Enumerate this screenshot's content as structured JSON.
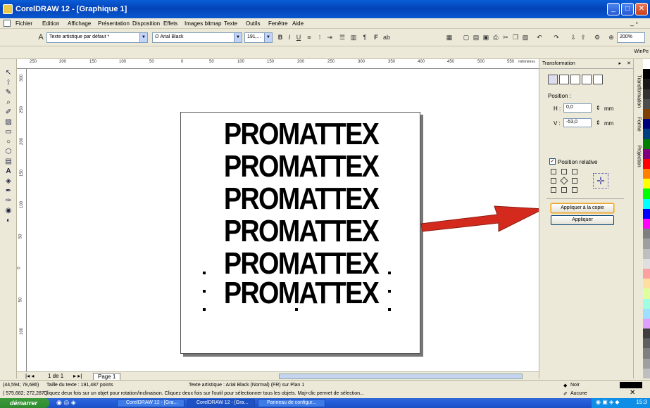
{
  "window": {
    "title": "CorelDRAW 12 - [Graphique 1]",
    "minimize": "_",
    "maximize": "□",
    "close": "✕"
  },
  "menu": [
    "Fichier",
    "Edition",
    "Affichage",
    "Présentation",
    "Disposition",
    "Effets",
    "Images bitmap",
    "Texte",
    "Outils",
    "Fenêtre",
    "Aide"
  ],
  "toolbar": {
    "style_combo": "Texte artistique par défaut *",
    "font_combo": "Arial Black",
    "size_combo": "191,...",
    "zoom": "200%",
    "winpe": "WinPe"
  },
  "ruler": {
    "h_ticks": [
      "250",
      "200",
      "150",
      "100",
      "50",
      "0",
      "50",
      "100",
      "150",
      "200",
      "250",
      "300",
      "350",
      "400",
      "450",
      "500",
      "550"
    ],
    "unit": "millimètres",
    "v_ticks": [
      "300",
      "250",
      "200",
      "150",
      "100",
      "50",
      "0",
      "50",
      "100"
    ]
  },
  "canvas": {
    "lines": [
      "PROMATTEX",
      "PROMATTEX",
      "PROMATTEX",
      "PROMATTEX",
      "PROMATTEX",
      "PROMATTEX"
    ]
  },
  "page_nav": {
    "counter": "1 de 1",
    "tab": "Page 1"
  },
  "docker": {
    "title": "Transformation",
    "position_label": "Position :",
    "h_label": "H :",
    "h_value": "0,0",
    "v_label": "V :",
    "v_value": "-53,0",
    "unit": "mm",
    "relative_label": "Position relative",
    "apply_copy": "Appliquer à la copie",
    "apply": "Appliquer"
  },
  "side_tabs": [
    "Transformation",
    "Forme",
    "Projection"
  ],
  "palette_colors": [
    "#ffffff",
    "#000000",
    "#1a1a1a",
    "#333333",
    "#4d4d4d",
    "#7f3f00",
    "#00007f",
    "#003f7f",
    "#007f00",
    "#7f007f",
    "#ff0000",
    "#ff7f00",
    "#ffff00",
    "#00ff00",
    "#00ffff",
    "#0000ff",
    "#ff00ff",
    "#7f7f7f",
    "#9f9f9f",
    "#bfbfbf",
    "#dfdfdf",
    "#ff9f9f",
    "#ffdf9f",
    "#dfff9f",
    "#9fffdf",
    "#9fdfff",
    "#df9fff",
    "#3f3f3f",
    "#5f5f5f",
    "#7f7f7f",
    "#9f9f9f",
    "#bfbfbf"
  ],
  "status": {
    "coords": "(44,594; 78,686)",
    "size": "Taille du texte : 191,487 points",
    "object_info": "Texte artistique : Arial Black (Normal) (FR) sur Plan 1",
    "fill": "Noir",
    "outline": "Aucune",
    "hint_coords": "( 575,682; 272,287 )",
    "hint": "Cliquez deux fois sur un objet pour rotation/inclinaison. Cliquez deux fois sur l'outil pour sélectionner tous les objets. Maj+clic permet de sélection..."
  },
  "taskbar": {
    "start": "démarrer",
    "tasks": [
      "CorelDRAW 12 - [Gra...",
      "CorelDRAW 12 - [Gra...",
      "Panneau de configur..."
    ],
    "clock": "15:3"
  },
  "colors": {
    "arrow": "#d42a1e",
    "title_blue": "#0a5ed8"
  }
}
